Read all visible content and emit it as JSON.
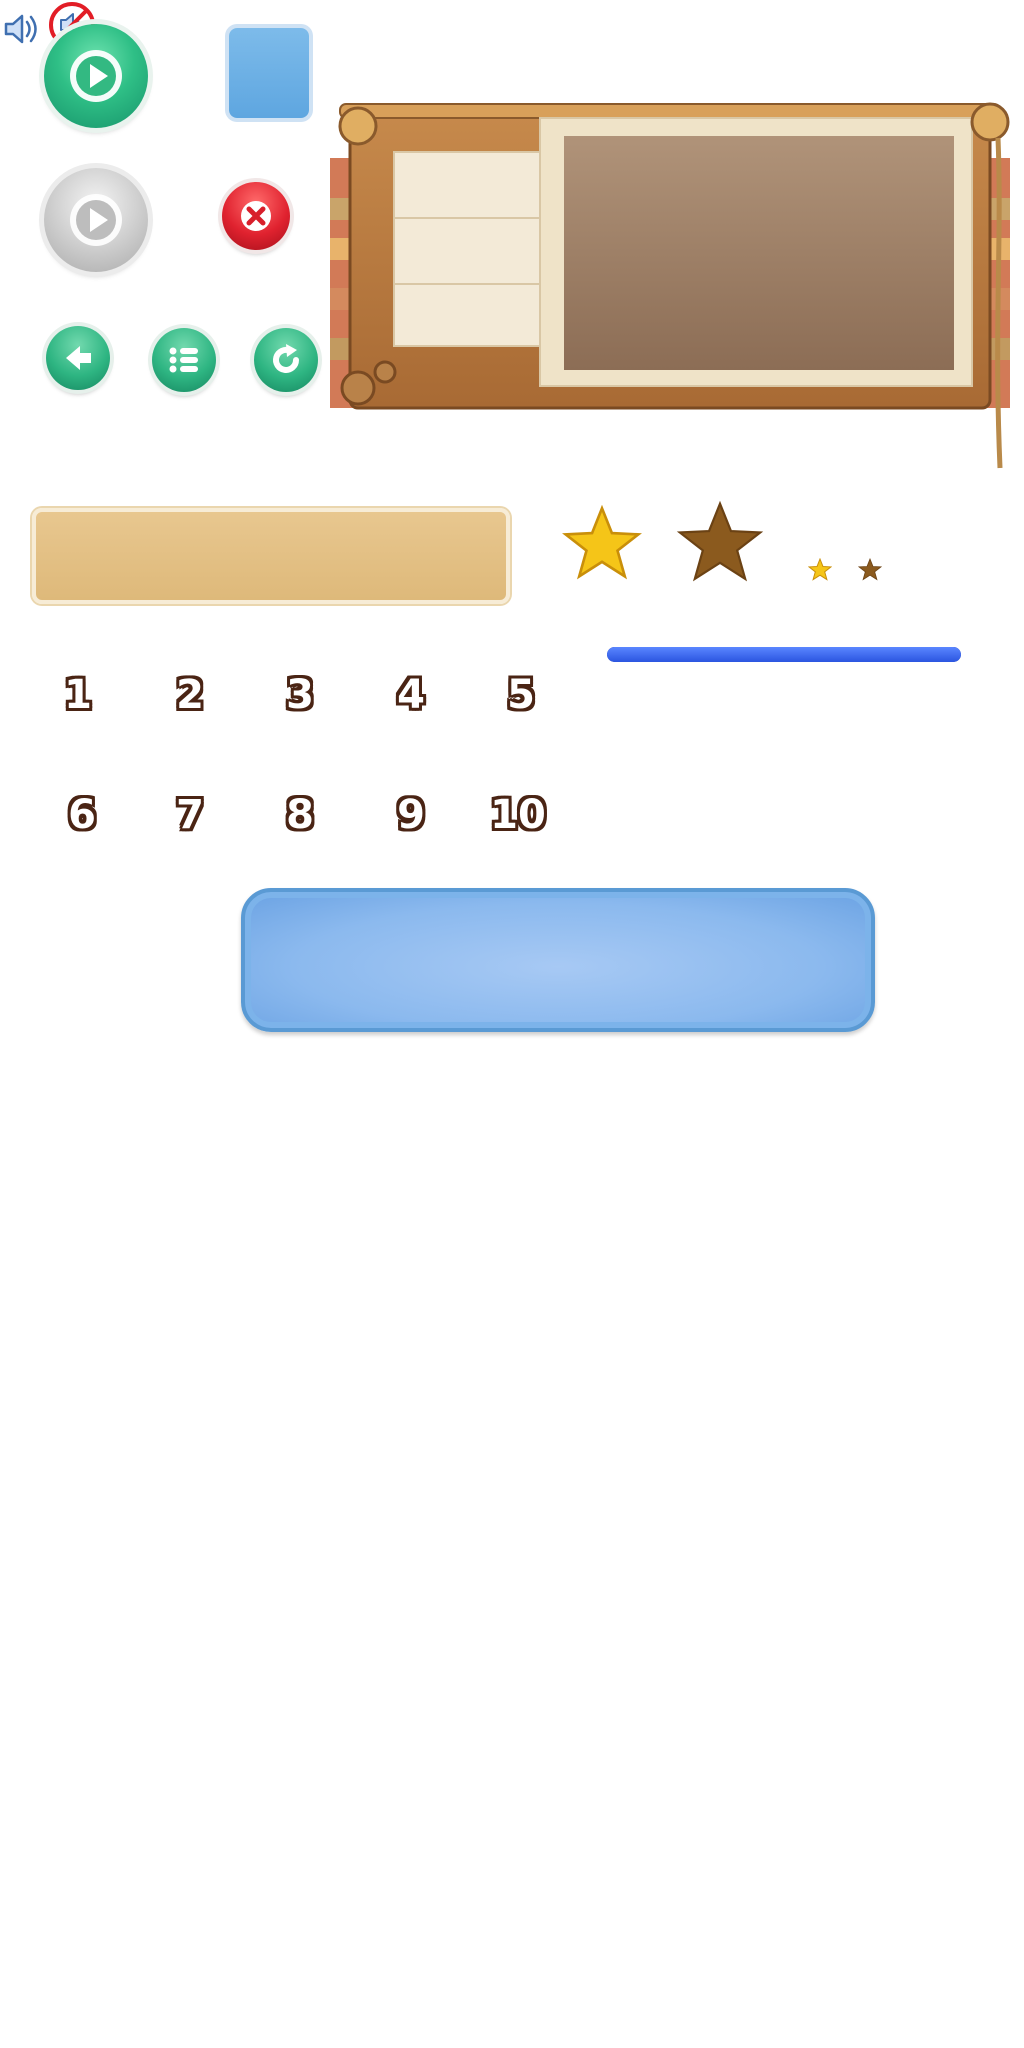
{
  "level_numbers": [
    "1",
    "2",
    "3",
    "4",
    "5",
    "6",
    "7",
    "8",
    "9",
    "10"
  ],
  "progress": {
    "fraction": 1.0
  },
  "stars": {
    "gold": "#f5c518",
    "brown": "#8b5a1e"
  },
  "colors": {
    "green_button": "#2fbf86",
    "grey_button": "#bdbdbd",
    "red_close": "#e0222f",
    "blue_square": "#6aaee3",
    "tan_panel": "#e2be80",
    "progress_blue": "#3a63ea",
    "blue_panel": "#92bdef"
  },
  "icons": [
    "play-icon",
    "close-icon",
    "back-arrow-icon",
    "menu-list-icon",
    "replay-icon",
    "sound-on-icon",
    "sound-off-icon",
    "star-icon"
  ]
}
